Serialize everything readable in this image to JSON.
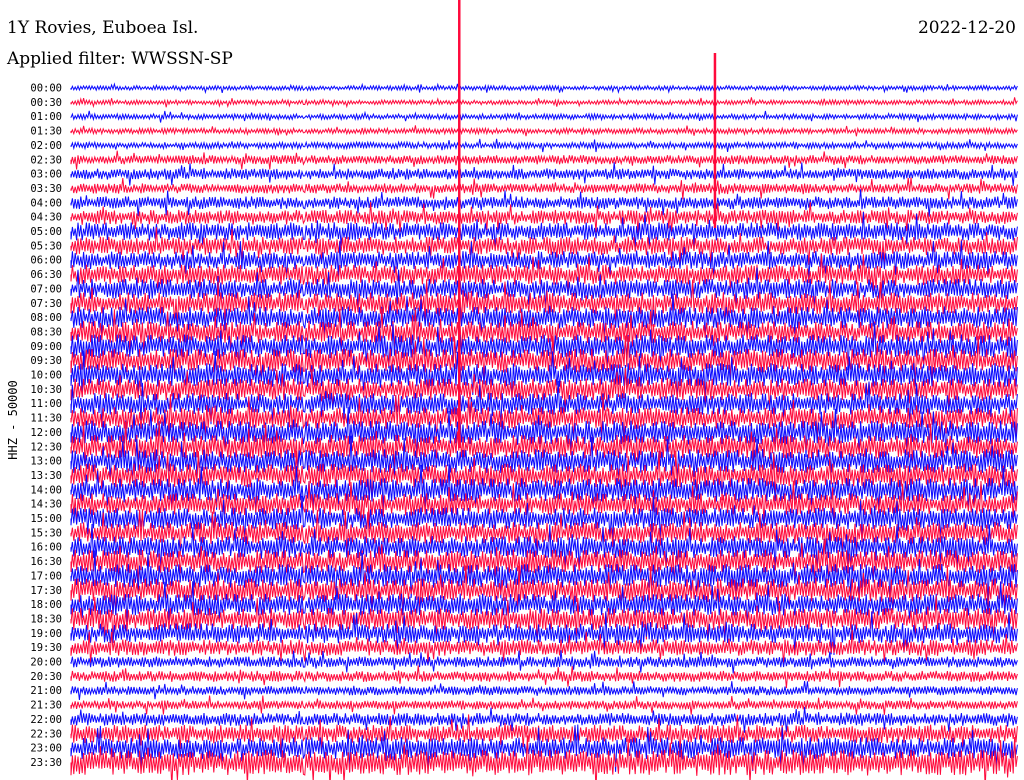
{
  "header": {
    "station": "1Y Rovies, Euboea Isl.",
    "date": "2022-12-20",
    "filter_label": "Applied filter: WWSSN-SP"
  },
  "y_axis_label": "HHZ - 50000",
  "colors": {
    "trace_a": "#0a0aff",
    "trace_b": "#ff0a3c",
    "background": "#ffffff"
  },
  "chart_data": {
    "type": "line",
    "subtype": "helicorder",
    "title": "1Y Rovies, Euboea Isl.",
    "subtitle": "Applied filter: WWSSN-SP",
    "ylabel": "HHZ - 50000",
    "row_interval_minutes": 30,
    "row_labels": [
      "00:00",
      "00:30",
      "01:00",
      "01:30",
      "02:00",
      "02:30",
      "03:00",
      "03:30",
      "04:00",
      "04:30",
      "05:00",
      "05:30",
      "06:00",
      "06:30",
      "07:00",
      "07:30",
      "08:00",
      "08:30",
      "09:00",
      "09:30",
      "10:00",
      "10:30",
      "11:00",
      "11:30",
      "12:00",
      "12:30",
      "13:00",
      "13:30",
      "14:00",
      "14:30",
      "15:00",
      "15:30",
      "16:00",
      "16:30",
      "17:00",
      "17:30",
      "18:00",
      "18:30",
      "19:00",
      "19:30",
      "20:00",
      "20:30",
      "21:00",
      "21:30",
      "22:00",
      "22:30",
      "23:00",
      "23:30"
    ],
    "trace_colors_alternating": [
      "blue",
      "red"
    ],
    "relative_amplitude_per_row": [
      0.25,
      0.25,
      0.3,
      0.3,
      0.35,
      0.5,
      0.6,
      0.55,
      0.7,
      0.8,
      1.0,
      1.0,
      1.0,
      1.1,
      1.1,
      1.2,
      1.2,
      1.2,
      1.3,
      1.3,
      1.3,
      1.2,
      1.2,
      1.2,
      1.3,
      1.3,
      1.3,
      1.3,
      1.3,
      1.2,
      1.2,
      1.2,
      1.2,
      1.3,
      1.3,
      1.3,
      1.2,
      1.2,
      1.1,
      0.9,
      0.6,
      0.6,
      0.5,
      0.5,
      0.7,
      1.0,
      1.2,
      1.4
    ],
    "notable_events": [
      {
        "row": "00:00",
        "x_fraction": 0.41,
        "amplitude": 9.0
      },
      {
        "row": "00:00",
        "x_fraction": 0.68,
        "amplitude": 3.5
      }
    ]
  }
}
